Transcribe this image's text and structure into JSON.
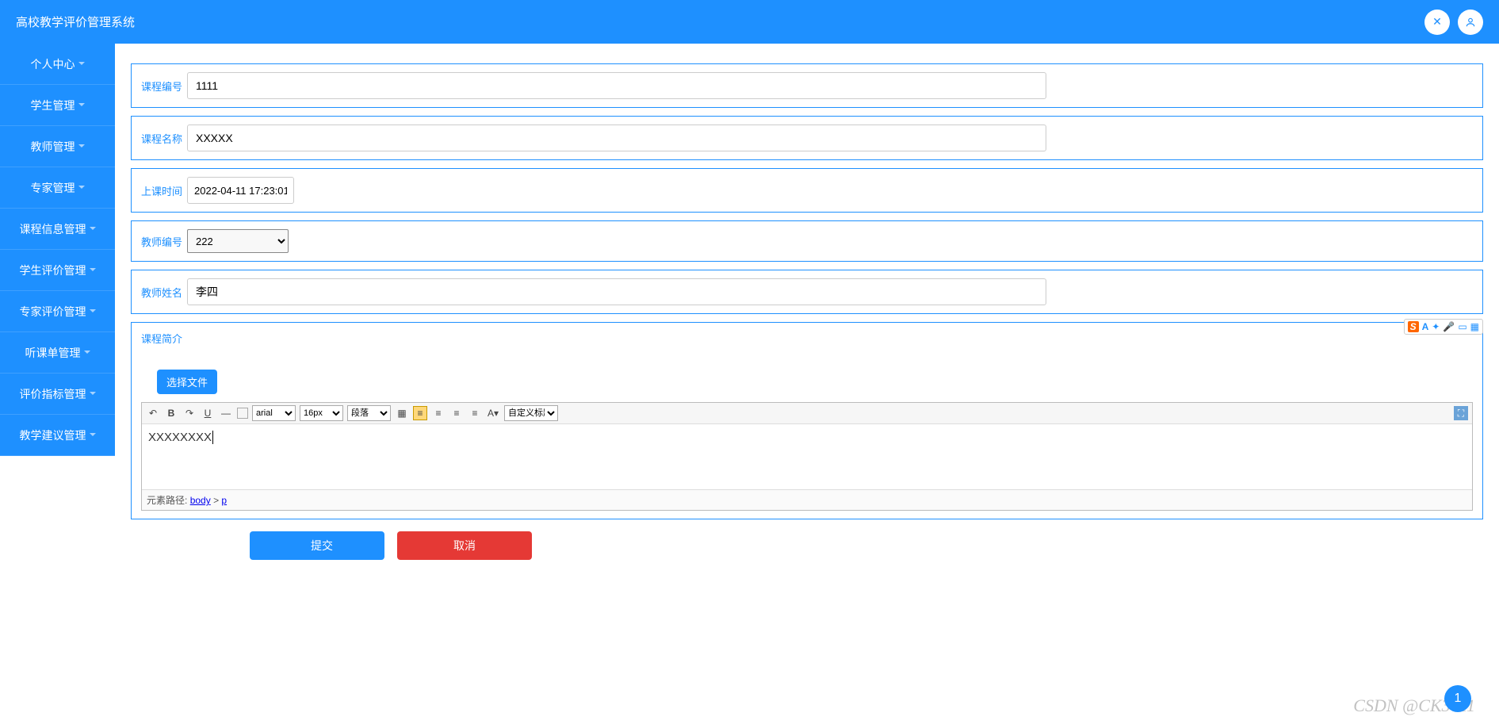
{
  "header": {
    "title": "高校教学评价管理系统"
  },
  "sidebar": {
    "items": [
      {
        "label": "个人中心"
      },
      {
        "label": "学生管理"
      },
      {
        "label": "教师管理"
      },
      {
        "label": "专家管理"
      },
      {
        "label": "课程信息管理"
      },
      {
        "label": "学生评价管理"
      },
      {
        "label": "专家评价管理"
      },
      {
        "label": "听课单管理"
      },
      {
        "label": "评价指标管理"
      },
      {
        "label": "教学建议管理"
      }
    ]
  },
  "form": {
    "course_id_label": "课程编号",
    "course_id_value": "1111",
    "course_name_label": "课程名称",
    "course_name_value": "XXXXX",
    "class_time_label": "上课时间",
    "class_time_value": "2022-04-11 17:23:01",
    "teacher_id_label": "教师编号",
    "teacher_id_value": "222",
    "teacher_name_label": "教师姓名",
    "teacher_name_value": "李四",
    "course_intro_label": "课程简介",
    "upload_label": "选择文件",
    "editor_content": "XXXXXXXX",
    "editor_font": "arial",
    "editor_size": "16px",
    "editor_para": "段落",
    "editor_custom": "自定义标题",
    "path_prefix": "元素路径:",
    "path_body": "body",
    "path_sep": " > ",
    "path_p": "p"
  },
  "actions": {
    "submit": "提交",
    "cancel": "取消"
  },
  "watermark": "CSDN @CK3011",
  "float_num": "1"
}
